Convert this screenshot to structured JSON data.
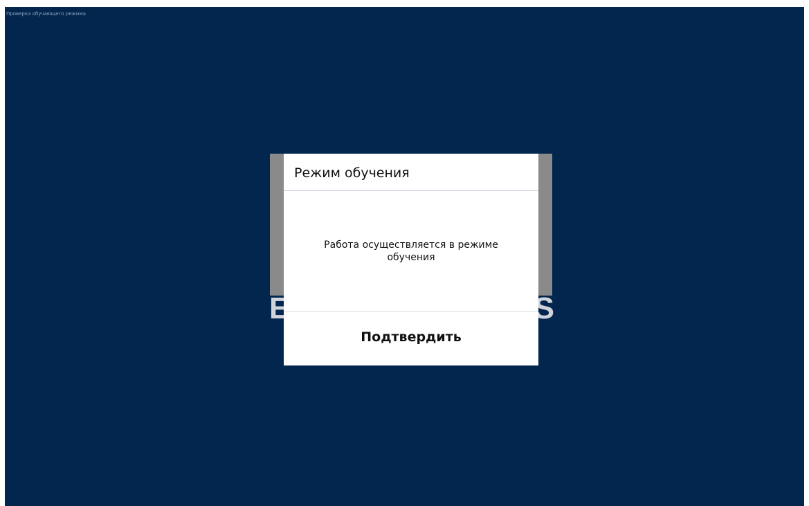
{
  "window": {
    "title": "Проверка обучающего режима",
    "background_color": "#02264e"
  },
  "backdrop": {
    "text_left": "E",
    "text_right": "S"
  },
  "dialog": {
    "title": "Режим обучения",
    "message": "Работа осуществляется в режиме обучения",
    "confirm_label": "Подтвердить"
  }
}
